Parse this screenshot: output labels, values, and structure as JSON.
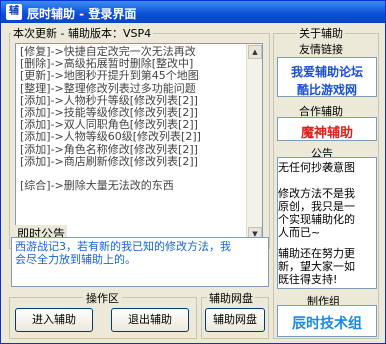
{
  "window": {
    "icon_glyph": "辅",
    "title": "辰时辅助 - 登录界面"
  },
  "update_panel": {
    "header": "本次更新 - 辅助版本：VSP4",
    "lines": [
      "[修复]->快捷自定改完一次无法再改",
      "[删除]->高级拓展暂时删除[整改中]",
      "[更新]->地图秒开提升到第45个地图",
      "[整理]->整理修改列表过多功能问题",
      "[添加]->人物秒升等级[修改列表[2]]",
      "[添加]->技能等级修改[修改列表[2]]",
      "[添加]->双人同职角色[修改列表[2]]",
      "[添加]->人物等级60级[修改列表[2]]",
      "[添加]->角色名称修改[修改列表[2]]",
      "[添加]->商店刷新修改[修改列表[2]]"
    ],
    "last_line": "[综合]->删除大量无法改的东西"
  },
  "notice": {
    "header": "即时公告",
    "text_line1": "西游战记3，若有新的我已知的修改方法，我",
    "text_line2": "会尽全力放到辅助上的。"
  },
  "operations": {
    "header": "操作区",
    "enter_label": "进入辅助",
    "exit_label": "退出辅助"
  },
  "helper_disk": {
    "header": "辅助网盘",
    "button_label": "辅助网盘"
  },
  "about": {
    "header": "关于辅助",
    "links_title": "友情链接",
    "link1": "我爱辅助论坛",
    "link2": "酷比游戏网",
    "partner_title": "合作辅助",
    "partner_name": "魔神辅助",
    "announcement_title": "公告",
    "announcement_lines": [
      "无任何抄袭意图",
      "",
      "修改方法不是我",
      "原创，我只是一",
      "个实现辅助化的",
      "人而已~",
      "",
      "辅助还在努力更",
      "新，望大家一如",
      "既往得支持!"
    ],
    "team_title": "制作组",
    "team_name": "辰时技术组"
  },
  "colors": {
    "title_bar": "#0a4fd8",
    "link_blue": "#1a4fd0",
    "partner_red": "#e0201a",
    "notice_text": "#1565d8",
    "team_blue": "#1a8ae6"
  }
}
